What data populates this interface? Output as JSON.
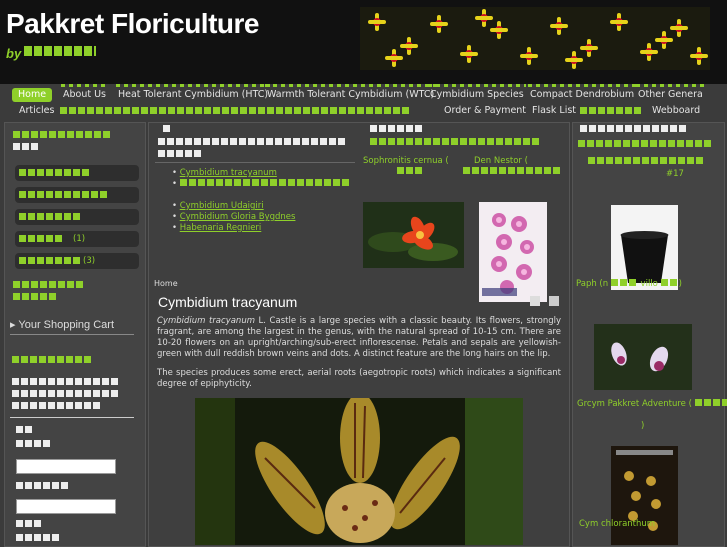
{
  "header": {
    "title": "Pakkret Floriculture",
    "by": "by"
  },
  "nav": {
    "row1": [
      {
        "label": "Home",
        "active": true
      },
      {
        "label": "About Us",
        "active": false
      },
      {
        "label": "Heat Tolerant Cymbidium (HTC)",
        "active": false
      },
      {
        "label": "Warmth Tolerant Cymbidium (WTC)",
        "active": false
      },
      {
        "label": "Cymbidium Species",
        "active": false
      },
      {
        "label": "Compact Dendrobium",
        "active": false
      },
      {
        "label": "Other Genera",
        "active": false
      }
    ],
    "row2": [
      {
        "label": "Articles"
      },
      {
        "label": "Order & Payment"
      },
      {
        "label": "Flask List"
      },
      {
        "label": "Webboard"
      }
    ]
  },
  "left": {
    "counts": [
      "(1)",
      "(3)"
    ],
    "shopping_cart": "Your Shopping Cart"
  },
  "middle": {
    "sidebar_links": [
      "Cymbidium tracyanum",
      "Cymbidium Udaigiri",
      "Cymbidium Gloria Bygdnes",
      "Habenaria Regnieri"
    ],
    "featured": [
      {
        "caption": "Sophronitis cernua (",
        "id": "soph"
      },
      {
        "caption": "Den Nestor (",
        "id": "den"
      }
    ],
    "breadcrumb": "Home",
    "page_title": "Cymbidium tracyanum",
    "paragraph1_em": "Cymbidium tracyanum",
    "paragraph1": " L. Castle is a large species with a classic beauty. Its flowers, strongly fragrant, are among the largest in the genus, with the natural spread of 10-15 cm. There are 10-20 flowers on an upright/arching/sub-erect inflorescense. Petals and sepals are yellowish-green with dull reddish brown veins and dots. A distinct feature are the long hairs on the lip.",
    "paragraph2": "The species produces some erect, aerial roots (aegotropic roots) which indicates a significant degree of epiphyticity."
  },
  "right": {
    "number": "#17",
    "items": [
      {
        "caption": "Paph (n",
        "caption2": "villo",
        "tail": ")"
      },
      {
        "caption": "Grcym Pakkret Adventure (",
        "tail": ")"
      },
      {
        "caption": "Cym chloranthum"
      }
    ]
  },
  "colors": {
    "accent": "#8fd02a",
    "bg": "#3b3b3b",
    "header": "#111111"
  }
}
